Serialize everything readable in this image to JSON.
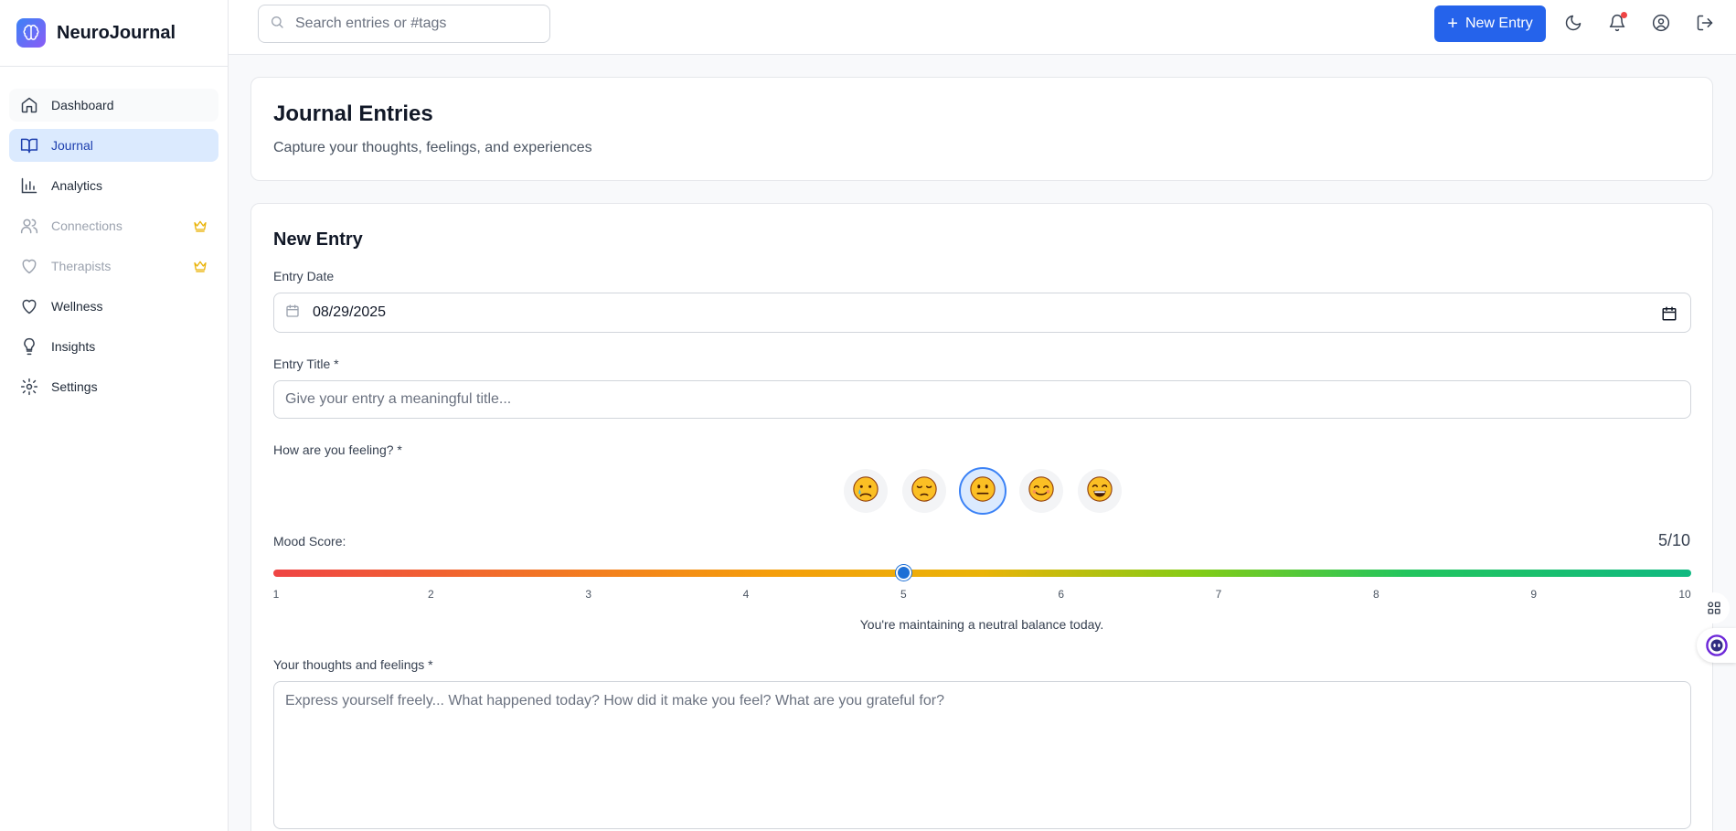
{
  "app": {
    "name": "NeuroJournal"
  },
  "search": {
    "placeholder": "Search entries or #tags"
  },
  "topbar": {
    "new_entry_label": "New Entry"
  },
  "sidebar": {
    "items": [
      {
        "label": "Dashboard",
        "icon": "home-icon",
        "state": "hover"
      },
      {
        "label": "Journal",
        "icon": "book-open-icon",
        "state": "active"
      },
      {
        "label": "Analytics",
        "icon": "bar-chart-icon",
        "state": "normal"
      },
      {
        "label": "Connections",
        "icon": "users-icon",
        "state": "locked",
        "badge_icon": "crown-icon"
      },
      {
        "label": "Therapists",
        "icon": "heart-icon",
        "state": "locked",
        "badge_icon": "crown-icon"
      },
      {
        "label": "Wellness",
        "icon": "heart-icon",
        "state": "normal"
      },
      {
        "label": "Insights",
        "icon": "lightbulb-icon",
        "state": "normal"
      },
      {
        "label": "Settings",
        "icon": "gear-icon",
        "state": "normal"
      }
    ]
  },
  "header": {
    "title": "Journal Entries",
    "subtitle": "Capture your thoughts, feelings, and experiences"
  },
  "form": {
    "title": "New Entry",
    "date_label": "Entry Date",
    "date_value": "08/29/2025",
    "title_label": "Entry Title *",
    "title_placeholder": "Give your entry a meaningful title...",
    "feeling_label": "How are you feeling? *",
    "moods": [
      {
        "emoji": "crying-face",
        "selected": false
      },
      {
        "emoji": "pensive-face",
        "selected": false
      },
      {
        "emoji": "neutral-face",
        "selected": true
      },
      {
        "emoji": "smiling-face",
        "selected": false
      },
      {
        "emoji": "grinning-face",
        "selected": false
      }
    ],
    "mood_score_label": "Mood Score:",
    "mood_score_value": 5,
    "mood_score_display": "5/10",
    "mood_min": 1,
    "mood_max": 10,
    "ticks": [
      "1",
      "2",
      "3",
      "4",
      "5",
      "6",
      "7",
      "8",
      "9",
      "10"
    ],
    "mood_message": "You're maintaining a neutral balance today.",
    "thoughts_label": "Your thoughts and feelings *",
    "thoughts_placeholder": "Express yourself freely... What happened today? How did it make you feel? What are you grateful for?"
  },
  "colors": {
    "primary": "#2563eb",
    "active_bg": "#dbeafe",
    "crown": "#eab308",
    "notification": "#ef4444",
    "slider_start": "#ef4444",
    "slider_mid": "#eab308",
    "slider_end": "#10b981"
  }
}
